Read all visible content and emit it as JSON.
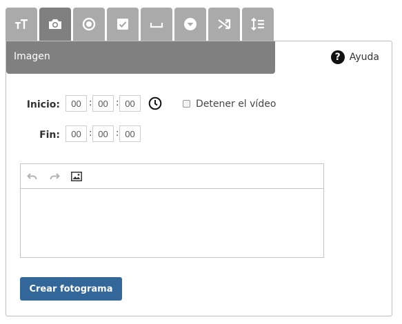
{
  "tabs": [
    {
      "icon": "text-size-icon",
      "active": false
    },
    {
      "icon": "camera-icon",
      "active": true
    },
    {
      "icon": "radio-button-icon",
      "active": false
    },
    {
      "icon": "checkbox-icon",
      "active": false
    },
    {
      "icon": "blank-space-icon",
      "active": false
    },
    {
      "icon": "dropdown-icon",
      "active": false
    },
    {
      "icon": "shuffle-icon",
      "active": false
    },
    {
      "icon": "ordering-icon",
      "active": false
    }
  ],
  "panel": {
    "title": "Imagen",
    "help_label": "Ayuda",
    "help_icon": "question-circle-icon"
  },
  "start": {
    "label": "Inicio:",
    "hours": "00",
    "minutes": "00",
    "seconds": "00",
    "separator": ":",
    "clock_icon": "clock-icon",
    "stop_video_label": "Detener el vídeo",
    "stop_video_checked": false
  },
  "end": {
    "label": "Fin:",
    "hours": "00",
    "minutes": "00",
    "seconds": "00",
    "separator": ":"
  },
  "editor": {
    "toolbar": [
      "undo-icon",
      "redo-icon",
      "image-icon"
    ],
    "content": ""
  },
  "create_button": {
    "label": "Crear fotograma",
    "color": "#336699"
  },
  "colors": {
    "tab_inactive": "#aaaaaa",
    "tab_active": "#808080",
    "header": "#808080"
  }
}
